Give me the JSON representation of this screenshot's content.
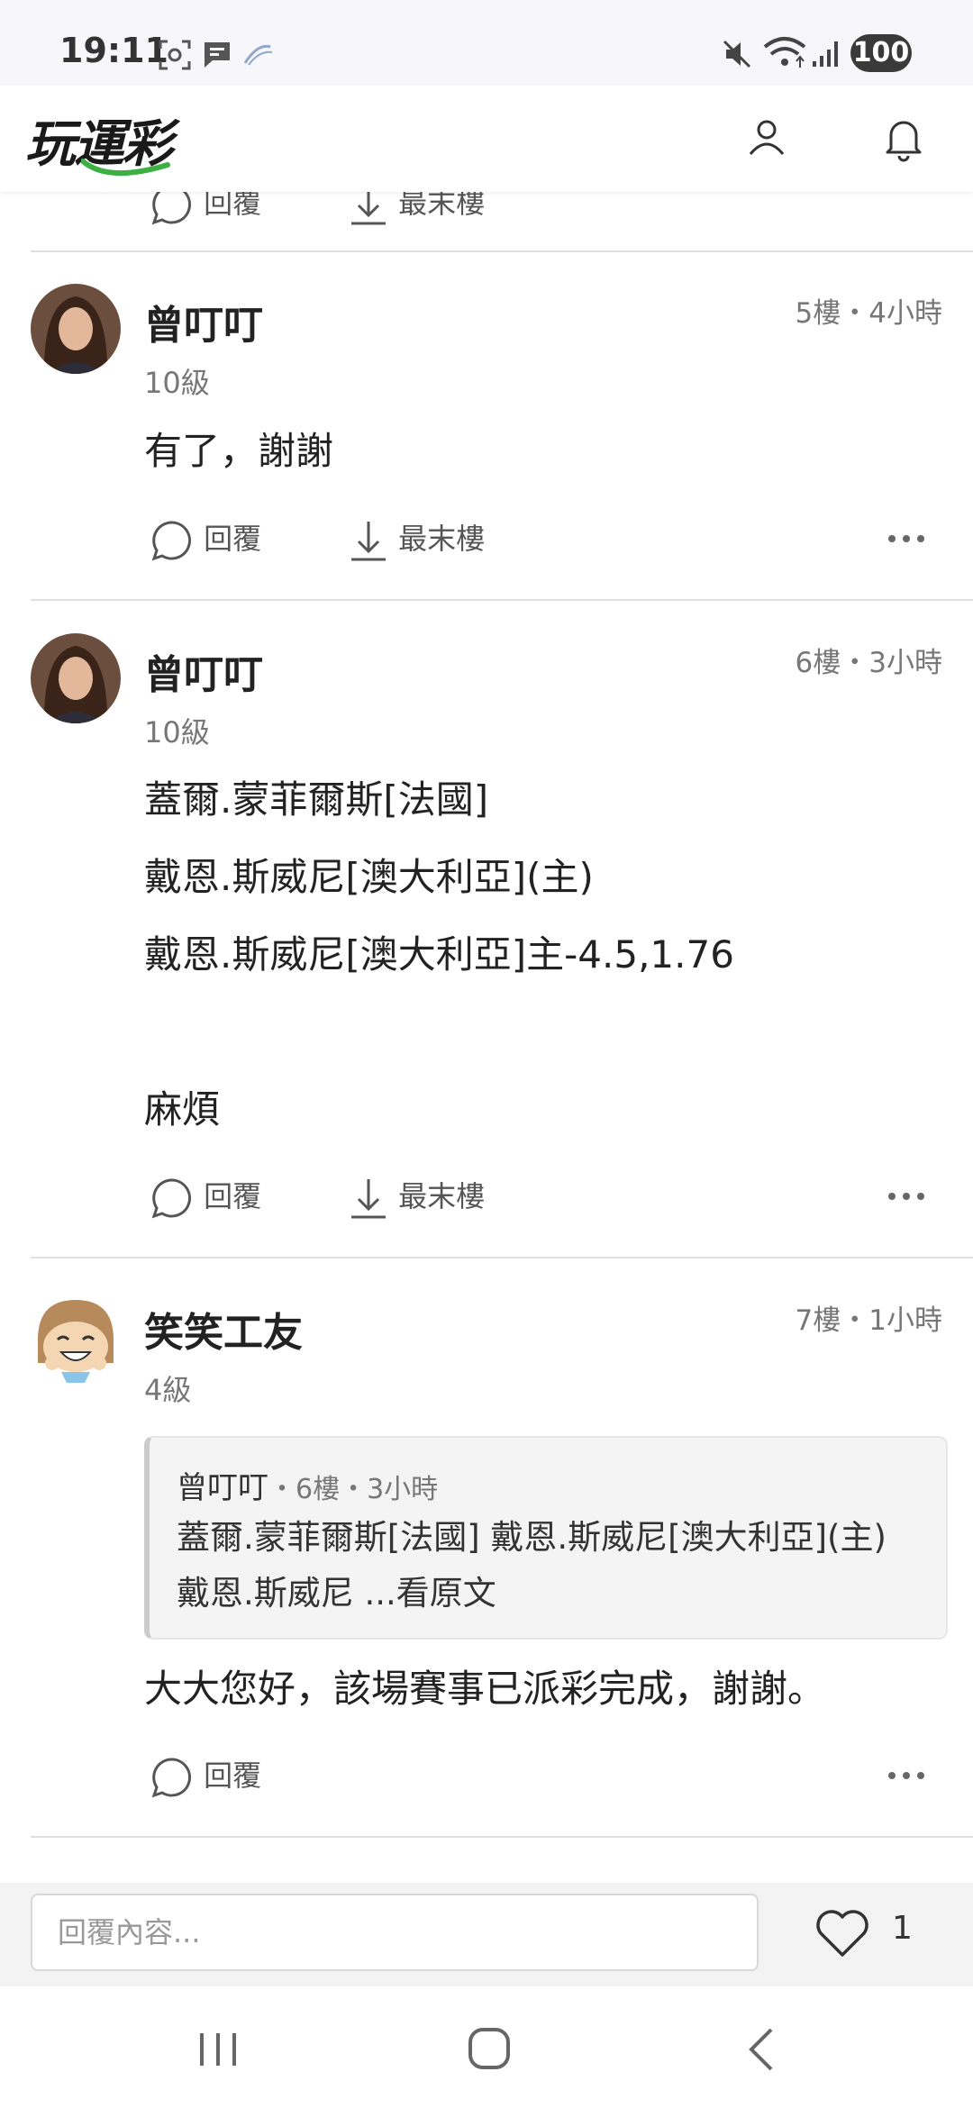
{
  "status_bar": {
    "time": "19:11",
    "battery": "100"
  },
  "header": {
    "logo_text": "玩運彩",
    "icons": [
      "user-icon",
      "bell-icon"
    ]
  },
  "partial_post": {
    "reply_label": "回覆",
    "last_floor_label": "最末樓"
  },
  "posts": [
    {
      "username": "曾叮叮",
      "level": "10級",
      "meta": "5樓・4小時",
      "content": [
        "有了，謝謝"
      ],
      "reply_label": "回覆",
      "last_floor_label": "最末樓"
    },
    {
      "username": "曾叮叮",
      "level": "10級",
      "meta": "6樓・3小時",
      "content": [
        "蓋爾.蒙菲爾斯[法國]",
        "戴恩.斯威尼[澳大利亞](主)",
        "戴恩.斯威尼[澳大利亞]主-4.5,1.76",
        "",
        "麻煩"
      ],
      "reply_label": "回覆",
      "last_floor_label": "最末樓"
    },
    {
      "username": "笑笑工友",
      "level": "4級",
      "meta": "7樓・1小時",
      "quote": {
        "author": "曾叮叮",
        "meta": "・6樓・3小時",
        "line1": "蓋爾.蒙菲爾斯[法國] 戴恩.斯威尼[澳大利亞](主)",
        "line2": "戴恩.斯威尼 ...看原文"
      },
      "content": [
        "大大您好，該場賽事已派彩完成，謝謝。"
      ],
      "reply_label": "回覆"
    }
  ],
  "bottom_bar": {
    "reply_placeholder": "回覆內容...",
    "like_count": "1"
  },
  "colors": {
    "accent_green": "#3cb043",
    "text_primary": "#222222",
    "text_secondary": "#777777",
    "divider": "#e0e0e0"
  }
}
